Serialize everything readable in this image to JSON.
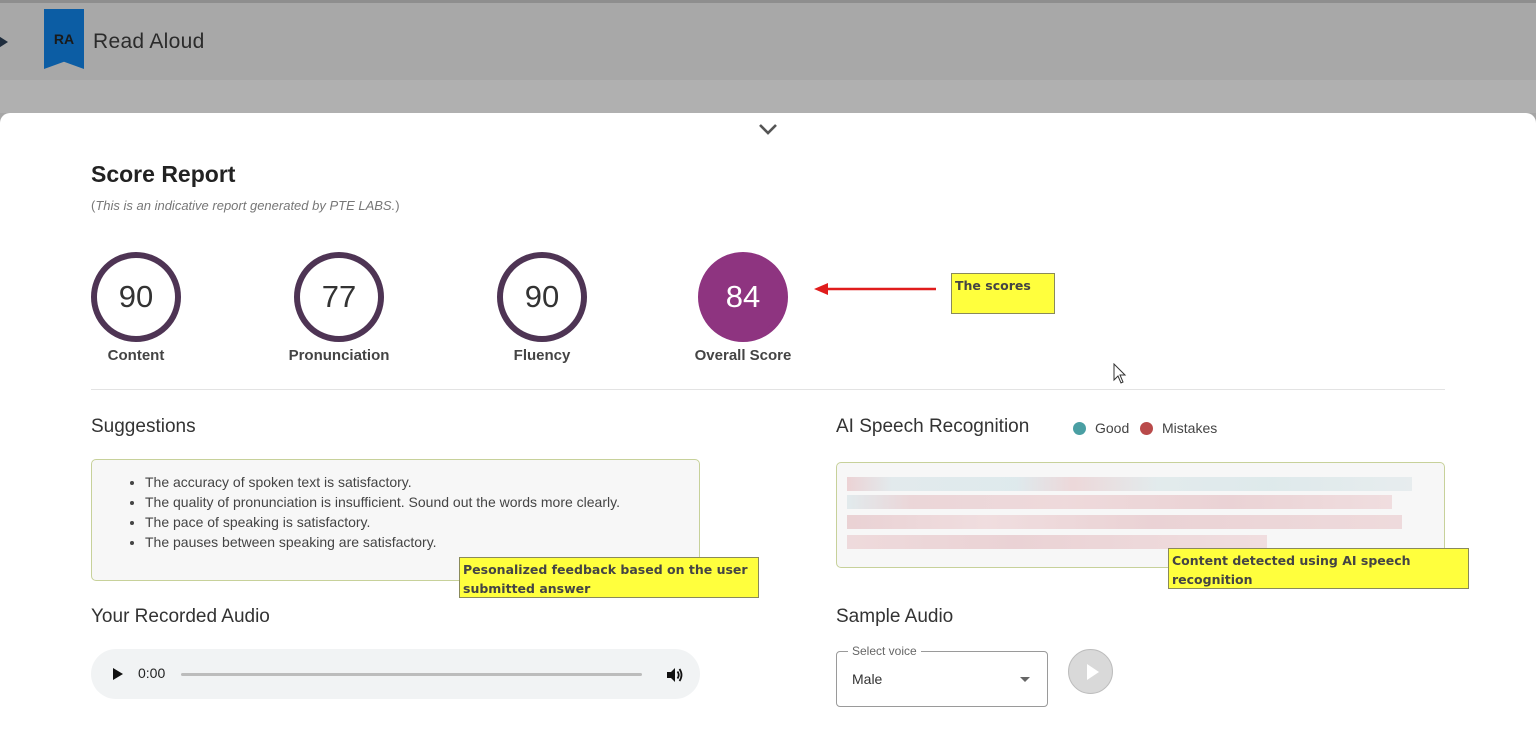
{
  "header": {
    "badge": "RA",
    "title": "Read Aloud"
  },
  "report": {
    "title": "Score Report",
    "subtitle_open": "(",
    "subtitle_italic": "This is an indicative report generated by PTE LABS.",
    "subtitle_close": ")"
  },
  "scores": [
    {
      "label": "Content",
      "value": "90"
    },
    {
      "label": "Pronunciation",
      "value": "77"
    },
    {
      "label": "Fluency",
      "value": "90"
    },
    {
      "label": "Overall Score",
      "value": "84"
    }
  ],
  "callouts": {
    "scores": "The scores",
    "feedback": "Pesonalized feedback based on the user submitted answer",
    "asr": "Content detected using AI speech recognition"
  },
  "suggestions": {
    "heading": "Suggestions",
    "items": [
      "The accuracy of spoken text is satisfactory.",
      "The quality of pronunciation is insufficient. Sound out the words more clearly.",
      "The pace of speaking is satisfactory.",
      "The pauses between speaking are satisfactory."
    ]
  },
  "asr": {
    "heading": "AI Speech Recognition",
    "legend_good": "Good",
    "legend_mistakes": "Mistakes",
    "good_color": "#4a9fa3",
    "mistake_color": "#b94a4a"
  },
  "recorded": {
    "heading": "Your Recorded Audio",
    "time": "0:00"
  },
  "sample": {
    "heading": "Sample Audio",
    "select_label": "Select voice",
    "select_value": "Male"
  },
  "colors": {
    "ring": "#4e3454",
    "overall": "#8e3480",
    "callout": "#ffff3d"
  }
}
